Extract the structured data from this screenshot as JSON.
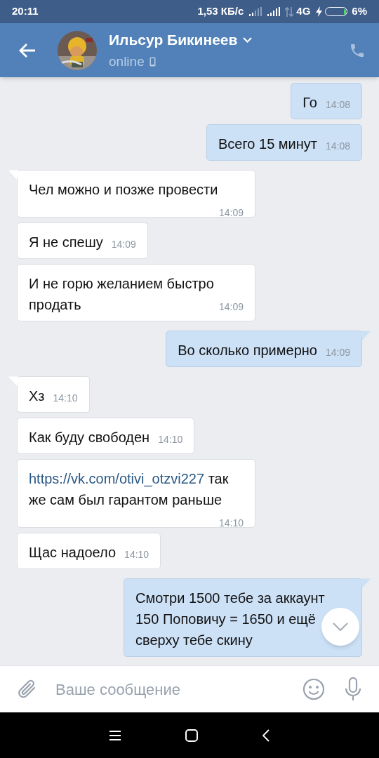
{
  "status_bar": {
    "time": "20:11",
    "speed": "1,53 КБ/с",
    "network": "4G",
    "battery": "6%"
  },
  "header": {
    "name": "Ильсур Бикинеев",
    "presence": "online"
  },
  "messages": [
    {
      "out": true,
      "tail": false,
      "text": "Го",
      "time": "14:08"
    },
    {
      "out": true,
      "tail": false,
      "text": "Всего 15 минут",
      "time": "14:08"
    },
    {
      "out": false,
      "tail": true,
      "text": "Чел можно и позже провести",
      "time": "14:09"
    },
    {
      "out": false,
      "tail": false,
      "text": "Я не спешу",
      "time": "14:09"
    },
    {
      "out": false,
      "tail": false,
      "text": "И не горю желанием быстро продать",
      "time": "14:09"
    },
    {
      "out": true,
      "tail": true,
      "text": "Во сколько примерно",
      "time": "14:09"
    },
    {
      "out": false,
      "tail": true,
      "text": "Хз",
      "time": "14:10"
    },
    {
      "out": false,
      "tail": false,
      "text": "Как буду свободен",
      "time": "14:10"
    },
    {
      "out": false,
      "tail": false,
      "link": "https://vk.com/otivi_otzvi227",
      "text": "так же сам был гарантом раньше",
      "time": "14:10"
    },
    {
      "out": false,
      "tail": false,
      "text": "Щас надоело",
      "time": "14:10"
    },
    {
      "out": true,
      "tail": true,
      "text": "Смотри 1500 тебе за аккаунт 150 Поповичу = 1650 и ещё сверху тебе скину"
    }
  ],
  "composer": {
    "placeholder": "Ваше сообщение"
  }
}
